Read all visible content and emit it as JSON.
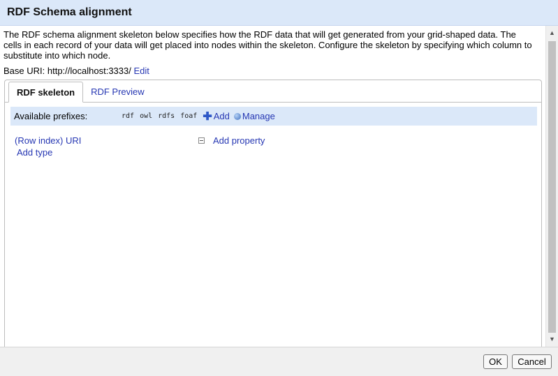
{
  "dialog": {
    "title": "RDF Schema alignment",
    "description": "The RDF schema alignment skeleton below specifies how the RDF data that will get generated from your grid-shaped data. The cells in each record of your data will get placed into nodes within the skeleton. Configure the skeleton by specifying which column to substitute into which node.",
    "base_uri_label": "Base URI:",
    "base_uri_value": "http://localhost:3333/",
    "base_uri_edit": "Edit"
  },
  "tabs": [
    {
      "label": "RDF skeleton",
      "active": true
    },
    {
      "label": "RDF Preview",
      "active": false
    }
  ],
  "prefixes": {
    "label": "Available prefixes:",
    "items": [
      "rdf",
      "owl",
      "rdfs",
      "foaf"
    ],
    "add_label": "Add",
    "manage_label": "Manage"
  },
  "skeleton": {
    "subject_label": "(Row index) URI",
    "add_type_label": "Add type",
    "add_property_label": "Add property"
  },
  "footer": {
    "ok_label": "OK",
    "cancel_label": "Cancel"
  },
  "colors": {
    "header_bg": "#dbe8f9",
    "link": "#2637b3",
    "prefix_bar_bg": "#dbe8f9"
  }
}
